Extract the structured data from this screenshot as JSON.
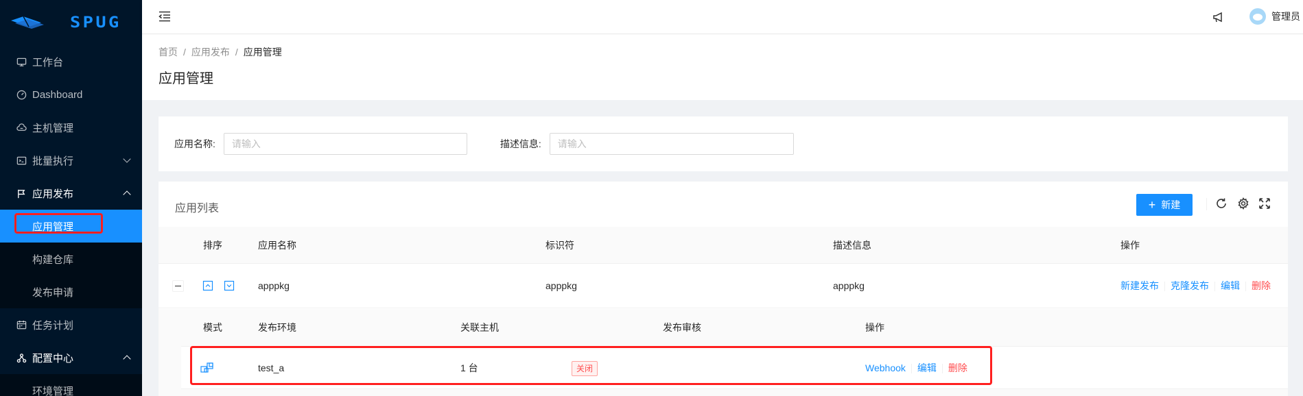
{
  "sidebar": {
    "logo_text": "SPUG",
    "items": [
      {
        "label": "工作台"
      },
      {
        "label": "Dashboard"
      },
      {
        "label": "主机管理"
      },
      {
        "label": "批量执行"
      },
      {
        "label": "应用发布"
      },
      {
        "label": "任务计划"
      },
      {
        "label": "配置中心"
      }
    ],
    "app_publish_children": [
      {
        "label": "应用管理"
      },
      {
        "label": "构建仓库"
      },
      {
        "label": "发布申请"
      }
    ],
    "config_children": [
      {
        "label": "环境管理"
      }
    ]
  },
  "header": {
    "user_name": "管理员"
  },
  "page": {
    "breadcrumb": [
      "首页",
      "应用发布",
      "应用管理"
    ],
    "title": "应用管理"
  },
  "search": {
    "name_label": "应用名称:",
    "name_placeholder": "请输入",
    "desc_label": "描述信息:",
    "desc_placeholder": "请输入"
  },
  "table": {
    "title": "应用列表",
    "new_button": "新建",
    "columns": [
      "排序",
      "应用名称",
      "标识符",
      "描述信息",
      "操作"
    ],
    "rows": [
      {
        "name": "apppkg",
        "key": "apppkg",
        "desc": "apppkg",
        "actions": [
          "新建发布",
          "克隆发布",
          "编辑",
          "删除"
        ]
      }
    ],
    "sub_columns": [
      "模式",
      "发布环境",
      "关联主机",
      "发布审核",
      "操作"
    ],
    "sub_rows": [
      {
        "env": "test_a",
        "hosts": "1 台",
        "review": "关闭",
        "actions": [
          "Webhook",
          "编辑",
          "删除"
        ]
      }
    ]
  },
  "colors": {
    "primary": "#1890ff",
    "sidebar_bg": "#001529",
    "danger": "#ff4d4f",
    "highlight": "#ff1f1f"
  }
}
